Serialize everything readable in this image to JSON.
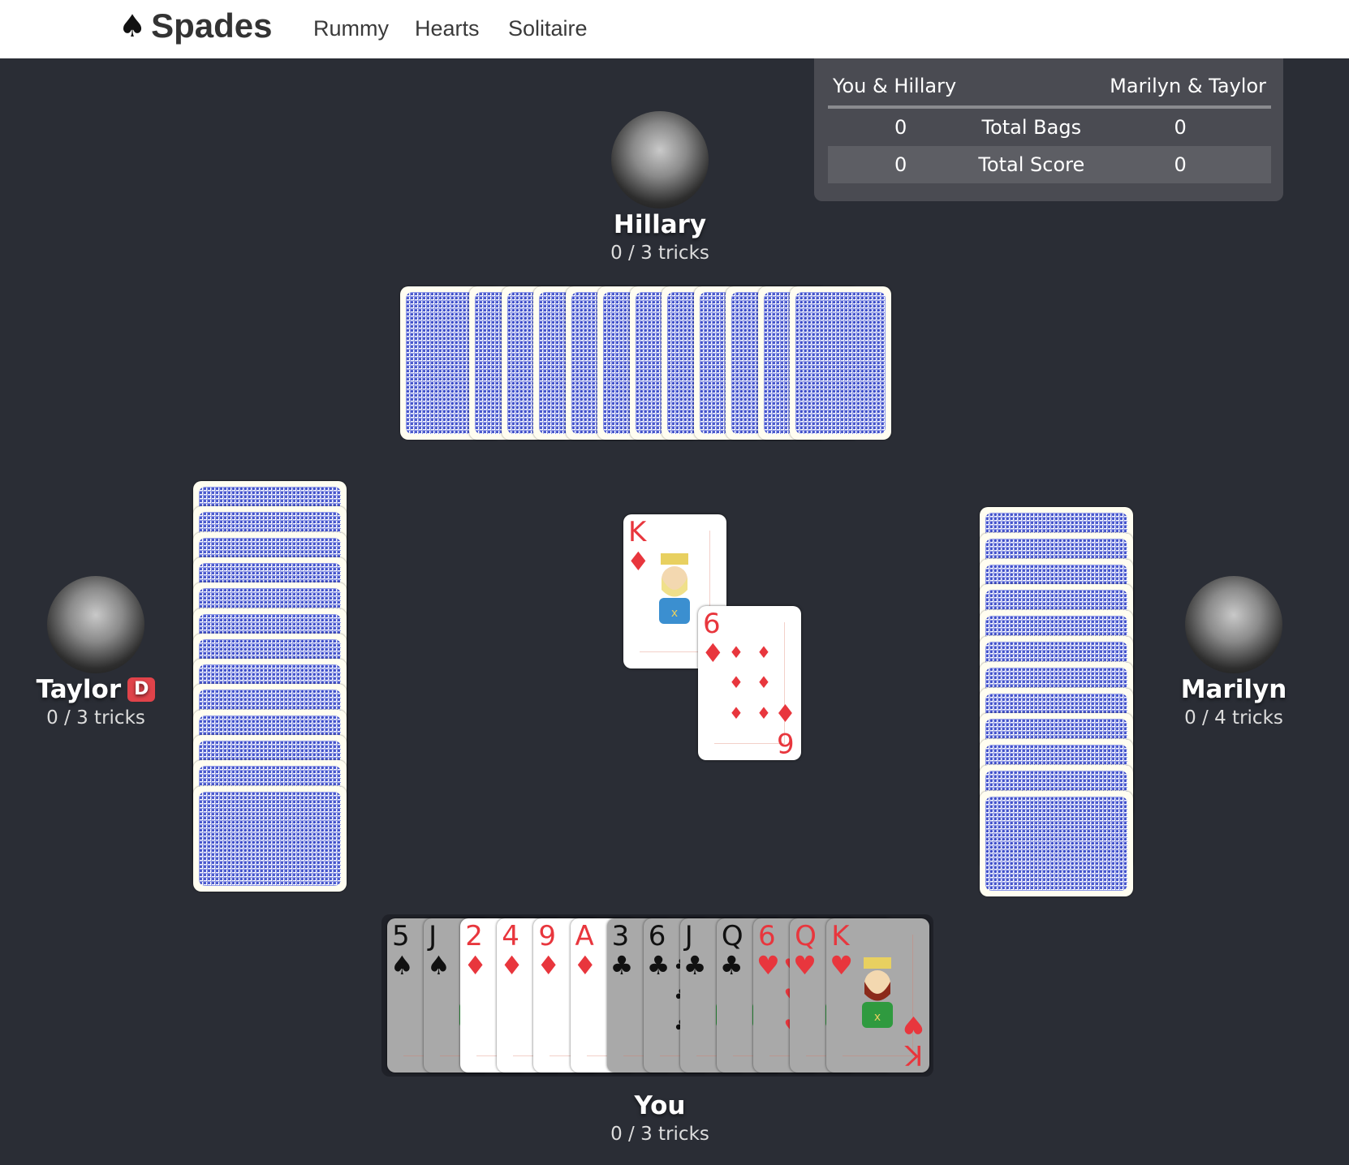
{
  "nav": {
    "brand_icon": "♠",
    "brand": "Spades",
    "links": [
      "Rummy",
      "Hearts",
      "Solitaire"
    ]
  },
  "scoreboard": {
    "team1": "You & Hillary",
    "team2": "Marilyn & Taylor",
    "rows": [
      {
        "label": "Total Bags",
        "team1": "0",
        "team2": "0"
      },
      {
        "label": "Total Score",
        "team1": "0",
        "team2": "0"
      }
    ]
  },
  "players": {
    "north": {
      "name": "Hillary",
      "tricks": "0 / 3 tricks",
      "avatar": "hillary-avatar",
      "cards_in_hand": 12
    },
    "west": {
      "name": "Taylor",
      "tricks": "0 / 3 tricks",
      "avatar": "taylor-avatar",
      "dealer_badge": "D",
      "cards_in_hand": 13
    },
    "east": {
      "name": "Marilyn",
      "tricks": "0 / 4 tricks",
      "avatar": "marilyn-avatar",
      "cards_in_hand": 12
    },
    "south": {
      "name": "You",
      "tricks": "0 / 3 tricks"
    }
  },
  "trick": [
    {
      "rank": "K",
      "suit": "♦",
      "color": "red",
      "played_by": "Hillary"
    },
    {
      "rank": "6",
      "suit": "♦",
      "color": "red",
      "played_by": "Marilyn"
    }
  ],
  "hand": [
    {
      "rank": "5",
      "suit": "♠",
      "color": "black",
      "playable": false
    },
    {
      "rank": "J",
      "suit": "♠",
      "color": "black",
      "playable": false
    },
    {
      "rank": "2",
      "suit": "♦",
      "color": "red",
      "playable": true
    },
    {
      "rank": "4",
      "suit": "♦",
      "color": "red",
      "playable": true
    },
    {
      "rank": "9",
      "suit": "♦",
      "color": "red",
      "playable": true
    },
    {
      "rank": "A",
      "suit": "♦",
      "color": "red",
      "playable": true
    },
    {
      "rank": "3",
      "suit": "♣",
      "color": "black",
      "playable": false
    },
    {
      "rank": "6",
      "suit": "♣",
      "color": "black",
      "playable": false
    },
    {
      "rank": "J",
      "suit": "♣",
      "color": "black",
      "playable": false
    },
    {
      "rank": "Q",
      "suit": "♣",
      "color": "black",
      "playable": false
    },
    {
      "rank": "6",
      "suit": "♥",
      "color": "red",
      "playable": false
    },
    {
      "rank": "Q",
      "suit": "♥",
      "color": "red",
      "playable": false
    },
    {
      "rank": "K",
      "suit": "♥",
      "color": "red",
      "playable": false
    }
  ],
  "colors": {
    "background": "#2a2d35",
    "dealer_badge": "#e0434a",
    "red_suit": "#e8363d"
  }
}
